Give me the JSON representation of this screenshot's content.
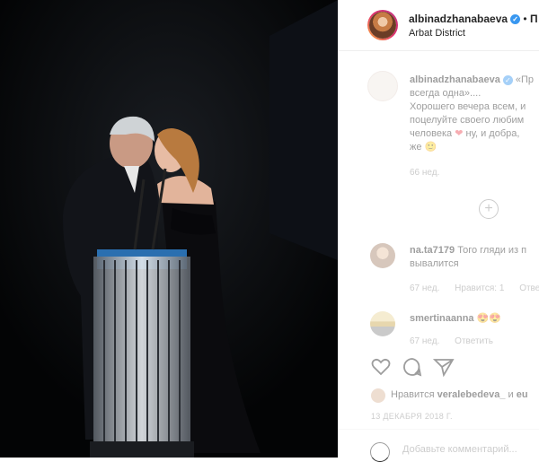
{
  "post": {
    "username": "albinadzhanabaeva",
    "separator": "•",
    "follow_label": "П",
    "location": "Arbat District"
  },
  "caption": {
    "username": "albinadzhanabaeva",
    "lines": [
      "«Пр",
      "всегда одна»....",
      "Хорошего вечера всем, и",
      "поцелуйте своего любим",
      "человека",
      "ну, и добра,",
      "же"
    ],
    "time": "66 нед."
  },
  "comments": [
    {
      "username": "na.ta7179",
      "text_line1": "Того гляди из п",
      "text_line2": "вывалится",
      "time": "67 нед.",
      "likes": "Нравится: 1",
      "reply": "Ответ"
    },
    {
      "username": "smertinaanna",
      "emoji": "😍😍",
      "time": "67 нед.",
      "reply": "Ответить"
    }
  ],
  "likes_text": {
    "prefix": "Нравится",
    "user": "veralebedeva_",
    "suffix": "и",
    "more": "eu"
  },
  "date": "13 ДЕКАБРЯ 2018 Г.",
  "add_comment": {
    "placeholder": "Добавьте комментарий..."
  },
  "icons": [
    "heart-icon",
    "comment-icon",
    "share-icon",
    "plus-icon",
    "emoji-icon",
    "verified-icon"
  ],
  "colors": {
    "accent": "#3897f0",
    "heart": "#ed4956",
    "muted": "#8e8e8e",
    "text": "#262626"
  }
}
